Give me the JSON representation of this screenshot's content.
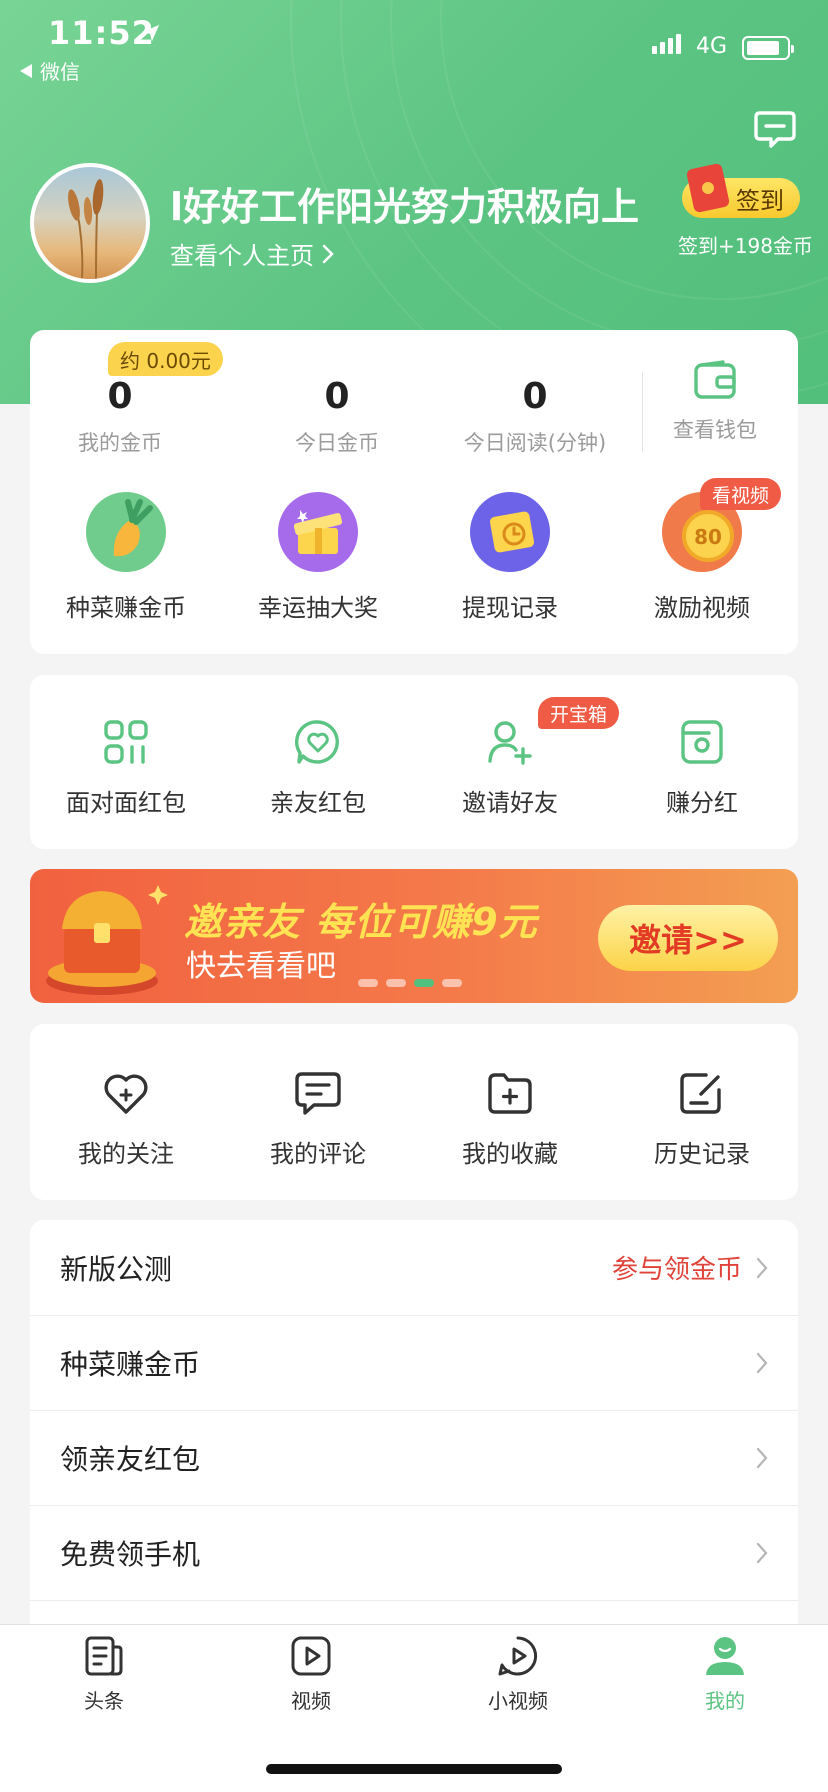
{
  "status_bar": {
    "time": "11:52",
    "back_app": "微信",
    "network": "4G"
  },
  "profile": {
    "username": "l好好工作阳光努力积极向上",
    "profile_link": "查看个人主页"
  },
  "signin": {
    "button_label": "签到",
    "reward": "签到+198金币"
  },
  "stats": {
    "approx_value": "约 0.00元",
    "items": [
      {
        "value": "0",
        "label": "我的金币"
      },
      {
        "value": "0",
        "label": "今日金币"
      },
      {
        "value": "0",
        "label": "今日阅读(分钟)"
      }
    ],
    "wallet_label": "查看钱包"
  },
  "features": [
    {
      "label": "种菜赚金币",
      "icon": "carrot-icon"
    },
    {
      "label": "幸运抽大奖",
      "icon": "gift-icon"
    },
    {
      "label": "提现记录",
      "icon": "clock-card-icon"
    },
    {
      "label": "激励视频",
      "icon": "coin-80-icon",
      "badge": "看视频",
      "coin_text": "80"
    }
  ],
  "grid2": [
    {
      "label": "面对面红包",
      "icon": "qr-grid-icon"
    },
    {
      "label": "亲友红包",
      "icon": "heart-bubble-icon"
    },
    {
      "label": "邀请好友",
      "icon": "add-user-icon",
      "badge": "开宝箱"
    },
    {
      "label": "赚分红",
      "icon": "wallet-card-icon"
    }
  ],
  "banner": {
    "title": "邀亲友 每位可赚9元",
    "subtitle": "快去看看吧",
    "button": "邀请>>",
    "dots_count": 4,
    "active_dot": 2
  },
  "grid3": [
    {
      "label": "我的关注",
      "icon": "heart-plus-icon"
    },
    {
      "label": "我的评论",
      "icon": "comment-icon"
    },
    {
      "label": "我的收藏",
      "icon": "folder-plus-icon"
    },
    {
      "label": "历史记录",
      "icon": "edit-note-icon"
    }
  ],
  "menu_list": [
    {
      "label": "新版公测",
      "right": "参与领金币"
    },
    {
      "label": "种菜赚金币",
      "right": ""
    },
    {
      "label": "领亲友红包",
      "right": ""
    },
    {
      "label": "免费领手机",
      "right": ""
    }
  ],
  "tabbar": {
    "items": [
      {
        "label": "头条",
        "icon": "news-icon"
      },
      {
        "label": "视频",
        "icon": "video-icon"
      },
      {
        "label": "小视频",
        "icon": "short-video-icon"
      },
      {
        "label": "我的",
        "icon": "profile-icon",
        "active": true
      }
    ]
  },
  "colors": {
    "brand_green": "#5cc483",
    "accent_red": "#e0433a",
    "banner_orange": "#f1613f",
    "gold": "#fcd34d"
  }
}
